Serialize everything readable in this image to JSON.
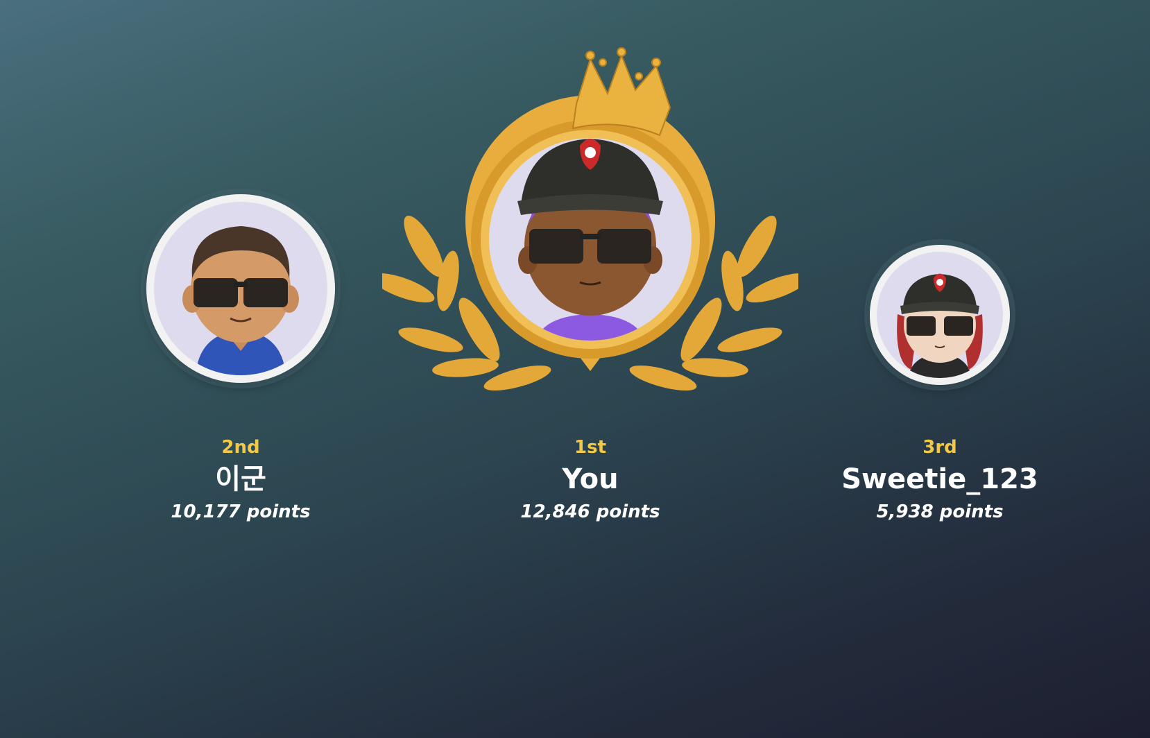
{
  "leaderboard": {
    "second": {
      "rank": "2nd",
      "name": "이군",
      "points": "10,177 points"
    },
    "first": {
      "rank": "1st",
      "name": "You",
      "points": "12,846 points"
    },
    "third": {
      "rank": "3rd",
      "name": "Sweetie_123",
      "points": "5,938 points"
    }
  },
  "colors": {
    "rank": "#f3c845",
    "gold": "#e6a93a",
    "avatar_bg": "#dedbee"
  }
}
